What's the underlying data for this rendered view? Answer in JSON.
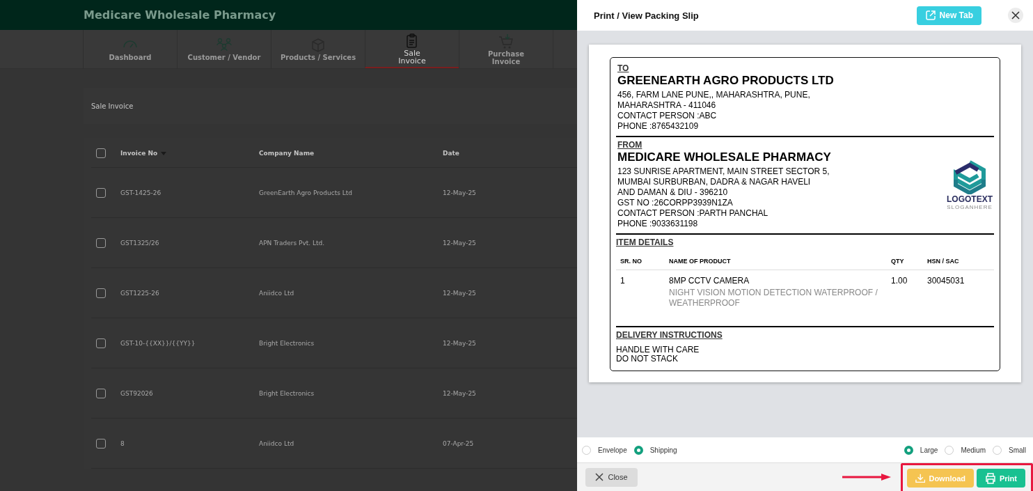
{
  "app": {
    "title": "Medicare Wholesale Pharmacy",
    "nav_tabs": [
      {
        "lines": [
          "Dashboard"
        ],
        "selected": false
      },
      {
        "lines": [
          "Customer / Vendor"
        ],
        "selected": false
      },
      {
        "lines": [
          "Products / Services"
        ],
        "selected": false
      },
      {
        "lines": [
          "Sale",
          "Invoice"
        ],
        "selected": true
      },
      {
        "lines": [
          "Purchase",
          "Invoice"
        ],
        "selected": false
      }
    ],
    "page_title": "Sale Invoice",
    "table": {
      "all_checked": false,
      "columns": [
        {
          "label": "Invoice No",
          "sorted": true
        },
        {
          "label": "Company Name",
          "sorted": false
        },
        {
          "label": "Date",
          "sorted": false
        }
      ],
      "rows": [
        {
          "checked": false,
          "cells": [
            "GST-1425-26",
            "GreenEarth Agro Products Ltd",
            "12-May-25"
          ]
        },
        {
          "checked": false,
          "cells": [
            "GST1325/26",
            "APN Traders Pvt. Ltd.",
            "12-May-25"
          ]
        },
        {
          "checked": false,
          "cells": [
            "GST1225-26",
            "Aniidco Ltd",
            "12-May-25"
          ]
        },
        {
          "checked": false,
          "cells": [
            "GST-10-{{XX}}/{{YY}}",
            "Bright Electronics",
            "12-May-25"
          ]
        },
        {
          "checked": false,
          "cells": [
            "GST92026",
            "Bright Electronics",
            "12-May-25"
          ]
        },
        {
          "checked": false,
          "cells": [
            "8",
            "Aniidco Ltd",
            "07-Apr-25"
          ]
        }
      ]
    }
  },
  "dialog": {
    "title": "Print / View Packing Slip",
    "new_tab_button": "New Tab",
    "slip": {
      "to": {
        "heading": "TO",
        "name": "GREENEARTH AGRO PRODUCTS LTD",
        "lines": [
          "456, FARM LANE PUNE,, MAHARASHTRA, PUNE,",
          "MAHARASHTRA - 411046",
          "CONTACT PERSON :ABC",
          "PHONE :8765432109"
        ]
      },
      "from": {
        "heading": "FROM",
        "name": "MEDICARE WHOLESALE PHARMACY",
        "lines": [
          "123 SUNRISE APARTMENT, MAIN STREET SECTOR 5,",
          "MUMBAI SURBURBAN, DADRA & NAGAR HAVELI",
          "AND DAMAN & DIU - 396210",
          "GST NO :26CORPP3939N1ZA",
          "CONTACT PERSON :PARTH PANCHAL",
          "PHONE :9033631198"
        ],
        "logo": {
          "text": "LOGOTEXT",
          "slogan": "SLOGANHERE"
        }
      },
      "items": {
        "heading": "ITEM DETAILS",
        "columns": [
          "SR. NO",
          "NAME OF PRODUCT",
          "QTY",
          "HSN / SAC"
        ],
        "rows": [
          {
            "sr": "1",
            "name": "8MP CCTV CAMERA",
            "description": "NIGHT VISION MOTION DETECTION WATERPROOF / WEATHERPROOF",
            "qty": "1.00",
            "hsn": "30045031"
          }
        ]
      },
      "delivery": {
        "heading": "DELIVERY INSTRUCTIONS",
        "lines": [
          "HANDLE WITH CARE",
          "DO NOT STACK"
        ]
      }
    },
    "slip_types": [
      {
        "label": "Envelope",
        "selected": false
      },
      {
        "label": "Shipping",
        "selected": true
      }
    ],
    "sizes": [
      {
        "label": "Large",
        "selected": true
      },
      {
        "label": "Medium",
        "selected": false
      },
      {
        "label": "Small",
        "selected": false
      }
    ],
    "close_button": "Close",
    "download_button": "Download",
    "print_button": "Print"
  }
}
